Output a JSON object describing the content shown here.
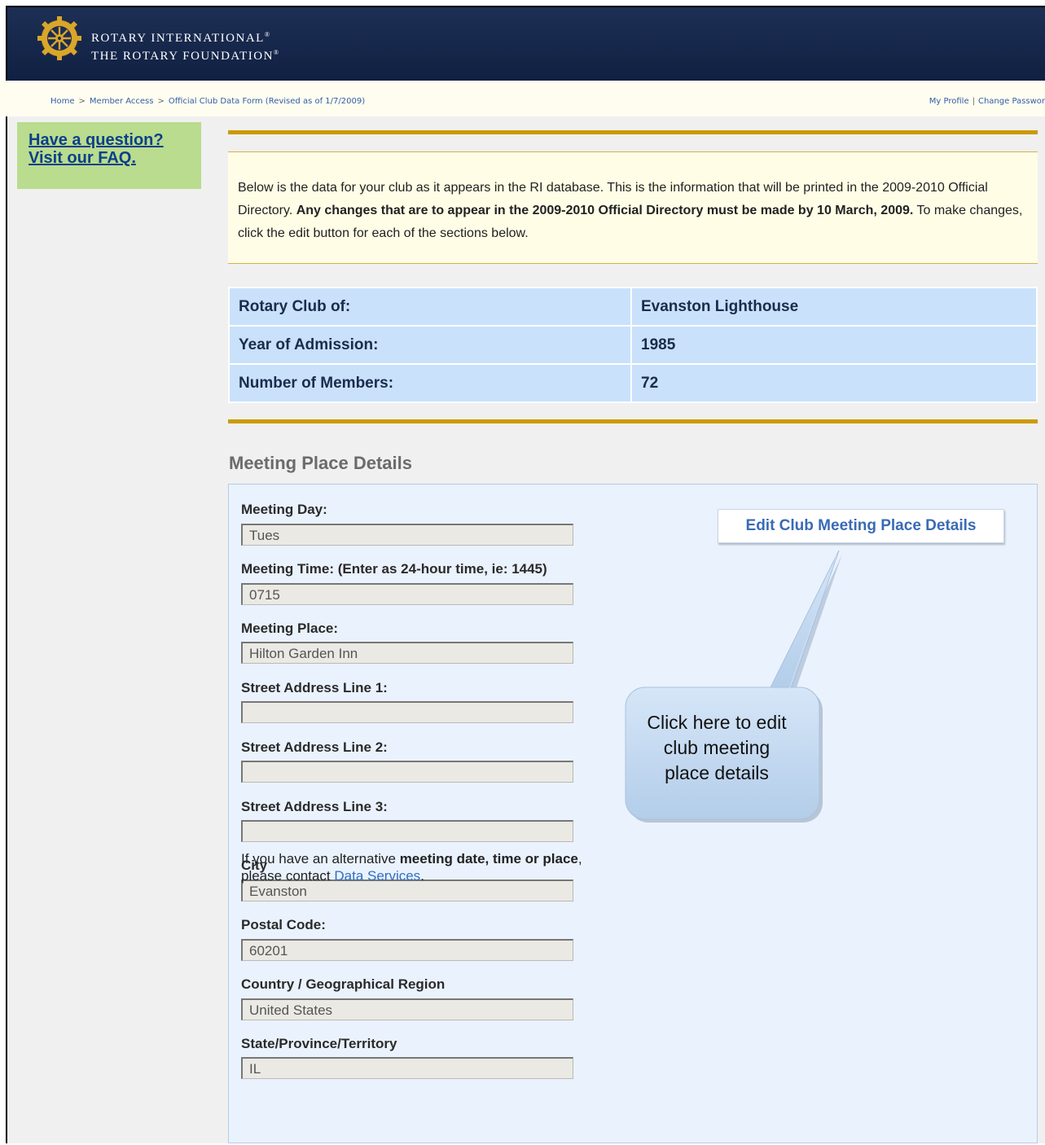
{
  "header": {
    "brand_line1": "ROTARY INTERNATIONAL",
    "brand_line2": "THE ROTARY FOUNDATION",
    "reg_mark": "®"
  },
  "breadcrumb": {
    "items": [
      "Home",
      "Member Access",
      "Official Club Data Form (Revised as of 1/7/2009)"
    ],
    "separator": ">"
  },
  "toplinks": {
    "profile": "My Profile",
    "separator": "|",
    "change_password": "Change Passwor"
  },
  "faq": {
    "line1": "Have a question?",
    "line2": "Visit our FAQ."
  },
  "intro": {
    "part1": "Below is the data for your club as it appears in the RI database. This is the information that will be printed in the 2009-2010 Official Directory. ",
    "bold": "Any changes that are to appear in the 2009-2010 Official Directory must be made by 10 March, 2009.",
    "part2": " To make changes, click the edit button for each of the sections below."
  },
  "club": {
    "rows": [
      {
        "label": "Rotary Club of:",
        "value": "Evanston Lighthouse"
      },
      {
        "label": "Year of Admission:",
        "value": "1985"
      },
      {
        "label": "Number of Members:",
        "value": "72"
      }
    ]
  },
  "meeting": {
    "section_title": "Meeting Place Details",
    "edit_button": "Edit Club Meeting Place Details",
    "fields": [
      {
        "label": "Meeting Day:",
        "value": "Tues"
      },
      {
        "label": "Meeting Time: (Enter as 24-hour time, ie: 1445)",
        "value": "0715"
      },
      {
        "label": "Meeting Place:",
        "value": "Hilton Garden Inn"
      },
      {
        "label": "Street Address Line 1:",
        "value": ""
      },
      {
        "label": "Street Address Line 2:",
        "value": ""
      },
      {
        "label": "Street Address Line 3:",
        "value": ""
      },
      {
        "label": "City",
        "value": "Evanston"
      },
      {
        "label": "Postal Code:",
        "value": "60201"
      },
      {
        "label": "Country / Geographical Region",
        "value": "United States"
      },
      {
        "label": "State/Province/Territory",
        "value": "IL"
      }
    ],
    "note_part1": "If you have an alternative ",
    "note_bold1": "meeting date, time or place",
    "note_part2": ", please contact ",
    "note_link": "Data Services",
    "note_end": "."
  },
  "callout": {
    "line1": "Click here to edit",
    "line2": "club meeting",
    "line3": "place details"
  },
  "colors": {
    "header_bg": "#15264a",
    "gold_rule": "#cc9a00",
    "faq_bg": "#b9dc8e",
    "table_bg": "#c9e1fb",
    "panel_bg": "#eaf2fd"
  }
}
